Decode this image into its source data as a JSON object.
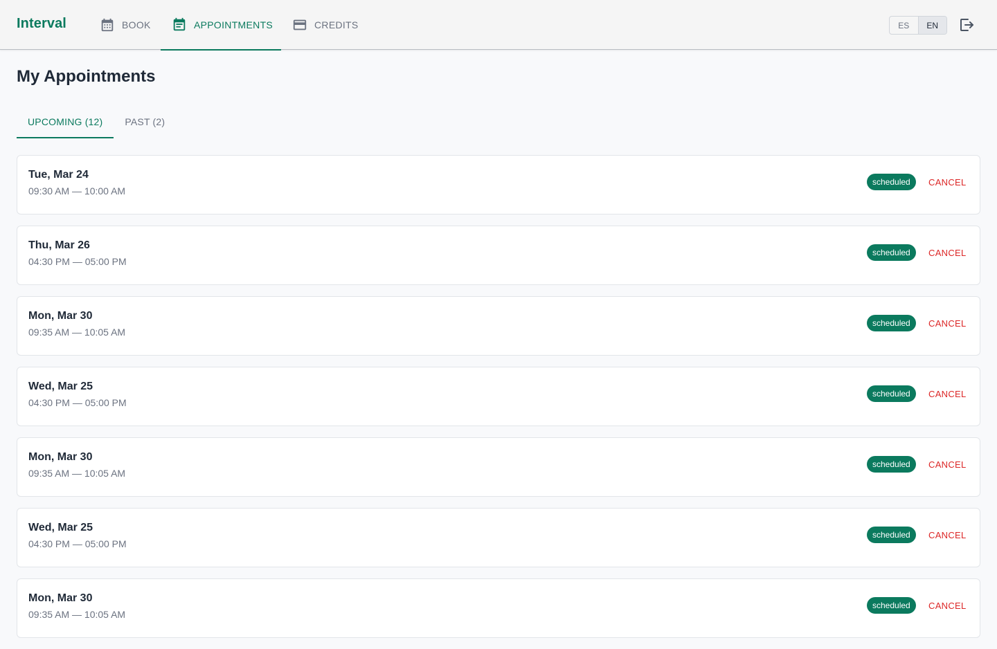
{
  "app": {
    "brand": "Interval"
  },
  "nav": {
    "items": [
      {
        "label": "BOOK",
        "icon": "calendar-icon",
        "active": false
      },
      {
        "label": "APPOINTMENTS",
        "icon": "event-note-icon",
        "active": true
      },
      {
        "label": "CREDITS",
        "icon": "credit-card-icon",
        "active": false
      }
    ]
  },
  "language": {
    "options": [
      "ES",
      "EN"
    ],
    "selected": "EN"
  },
  "logout": {
    "icon": "logout-icon"
  },
  "page": {
    "title": "My Appointments",
    "tabs": [
      {
        "label": "UPCOMING (12)",
        "active": true
      },
      {
        "label": "PAST (2)",
        "active": false
      }
    ]
  },
  "appointments": [
    {
      "date": "Tue, Mar 24",
      "time": "09:30 AM — 10:00 AM",
      "status": "scheduled",
      "action": "CANCEL"
    },
    {
      "date": "Thu, Mar 26",
      "time": "04:30 PM — 05:00 PM",
      "status": "scheduled",
      "action": "CANCEL"
    },
    {
      "date": "Mon, Mar 30",
      "time": "09:35 AM — 10:05 AM",
      "status": "scheduled",
      "action": "CANCEL"
    },
    {
      "date": "Wed, Mar 25",
      "time": "04:30 PM — 05:00 PM",
      "status": "scheduled",
      "action": "CANCEL"
    },
    {
      "date": "Mon, Mar 30",
      "time": "09:35 AM — 10:05 AM",
      "status": "scheduled",
      "action": "CANCEL"
    },
    {
      "date": "Wed, Mar 25",
      "time": "04:30 PM — 05:00 PM",
      "status": "scheduled",
      "action": "CANCEL"
    },
    {
      "date": "Mon, Mar 30",
      "time": "09:35 AM — 10:05 AM",
      "status": "scheduled",
      "action": "CANCEL"
    }
  ],
  "colors": {
    "accent": "#0b7a5e",
    "danger": "#dc2626",
    "muted_text": "#6b7280",
    "topbar_bg": "#f5f5f5",
    "page_bg": "#f8f9fb"
  }
}
